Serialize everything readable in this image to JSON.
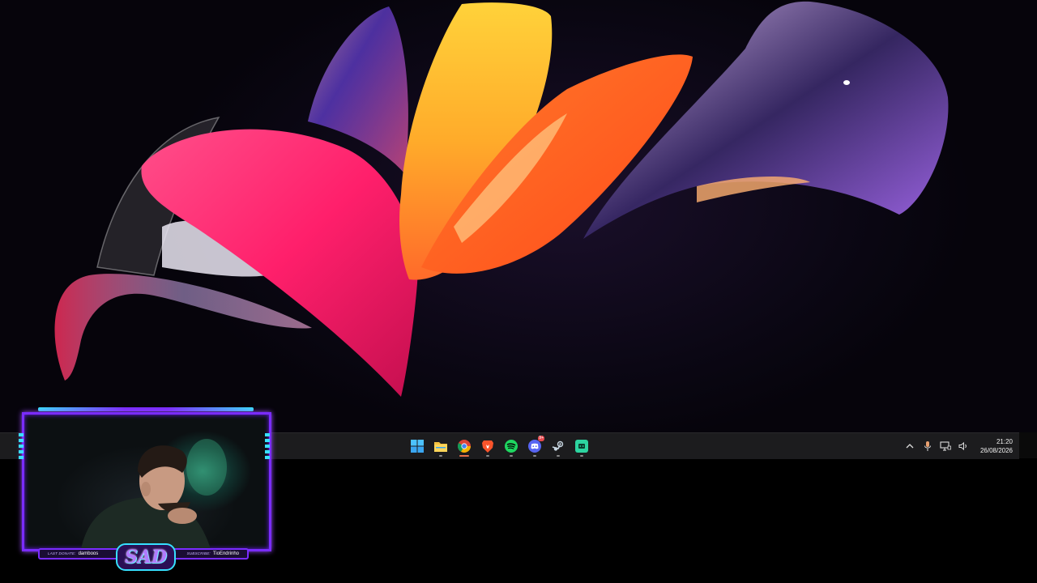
{
  "taskbar": {
    "apps": [
      {
        "name": "start-button",
        "icon": "windows-logo-icon",
        "running": false
      },
      {
        "name": "file-explorer-button",
        "icon": "folder-icon",
        "running": true
      },
      {
        "name": "chrome-button",
        "icon": "chrome-icon",
        "running": true,
        "active": true
      },
      {
        "name": "brave-button",
        "icon": "brave-lion-icon",
        "running": true
      },
      {
        "name": "spotify-button",
        "icon": "spotify-icon",
        "running": true
      },
      {
        "name": "discord-button",
        "icon": "discord-icon",
        "running": true,
        "badge": "9+"
      },
      {
        "name": "steam-button",
        "icon": "steam-icon",
        "running": true
      },
      {
        "name": "app-button",
        "icon": "green-app-icon",
        "running": true
      }
    ],
    "tray": {
      "clock_time": "21:20",
      "clock_date": "26/08/2026"
    }
  },
  "overlay": {
    "logo": "SAD",
    "last_donate_label": "LAST DONATE:",
    "last_donate_value": "damboos",
    "subscribe_label": "SUBSCRIBE:",
    "subscribe_value": "TioEndrinho"
  },
  "colors": {
    "accent_purple": "#7a2cff",
    "accent_cyan": "#37e0ff",
    "taskbar_bg": "#1c1c1e"
  }
}
